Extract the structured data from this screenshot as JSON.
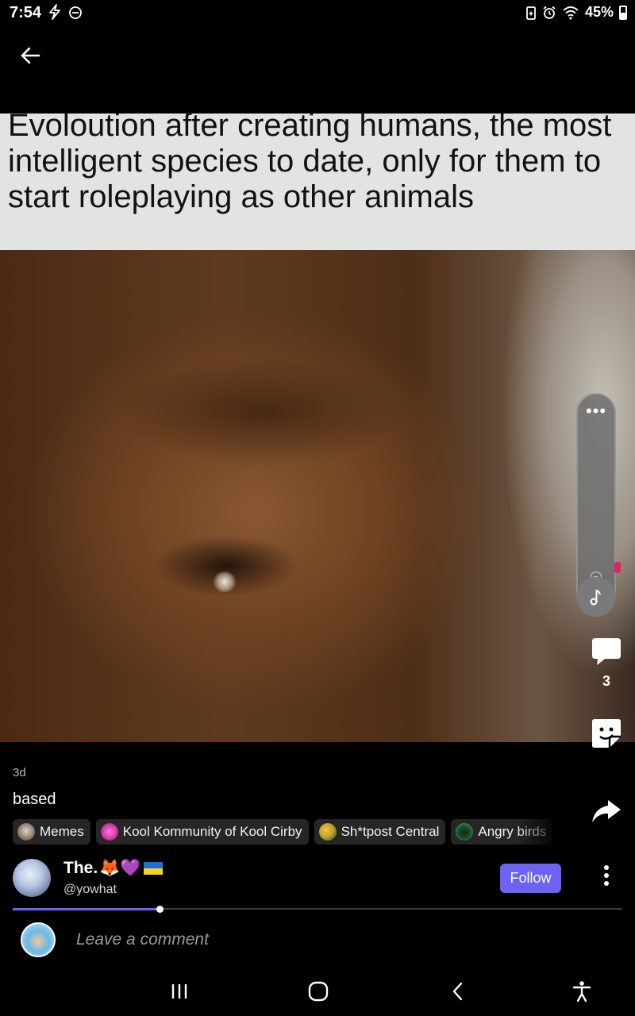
{
  "status_bar": {
    "time": "7:54",
    "battery": "45%",
    "icons": [
      "flash-icon",
      "do-not-disturb-icon",
      "battery-saver-icon",
      "alarm-icon",
      "wifi-icon",
      "battery-icon"
    ]
  },
  "meme": {
    "caption": "Evoloution after creating humans, the most intelligent species to date, only for them to start roleplaying as other animals"
  },
  "side_controls": {
    "more_label": "•••",
    "comment_count": "3"
  },
  "post": {
    "age": "3d",
    "text": "based",
    "tags": [
      {
        "label": "Memes",
        "color": "#8a7a6a"
      },
      {
        "label": "Kool Kommunity of Kool Cirby",
        "color": "#d43ca8"
      },
      {
        "label": "Sh*tpost Central",
        "color": "#c9a227"
      },
      {
        "label": "Angry birds",
        "color": "#2e7d4a"
      }
    ]
  },
  "author": {
    "name": "The.",
    "name_emojis": "🦊💜",
    "handle": "@yowhat",
    "follow_label": "Follow"
  },
  "progress": {
    "fraction": 0.241
  },
  "comment_box": {
    "placeholder": "Leave a comment"
  },
  "colors": {
    "accent": "#6c63f2",
    "tag_bg": "#262626",
    "background": "#000000"
  }
}
